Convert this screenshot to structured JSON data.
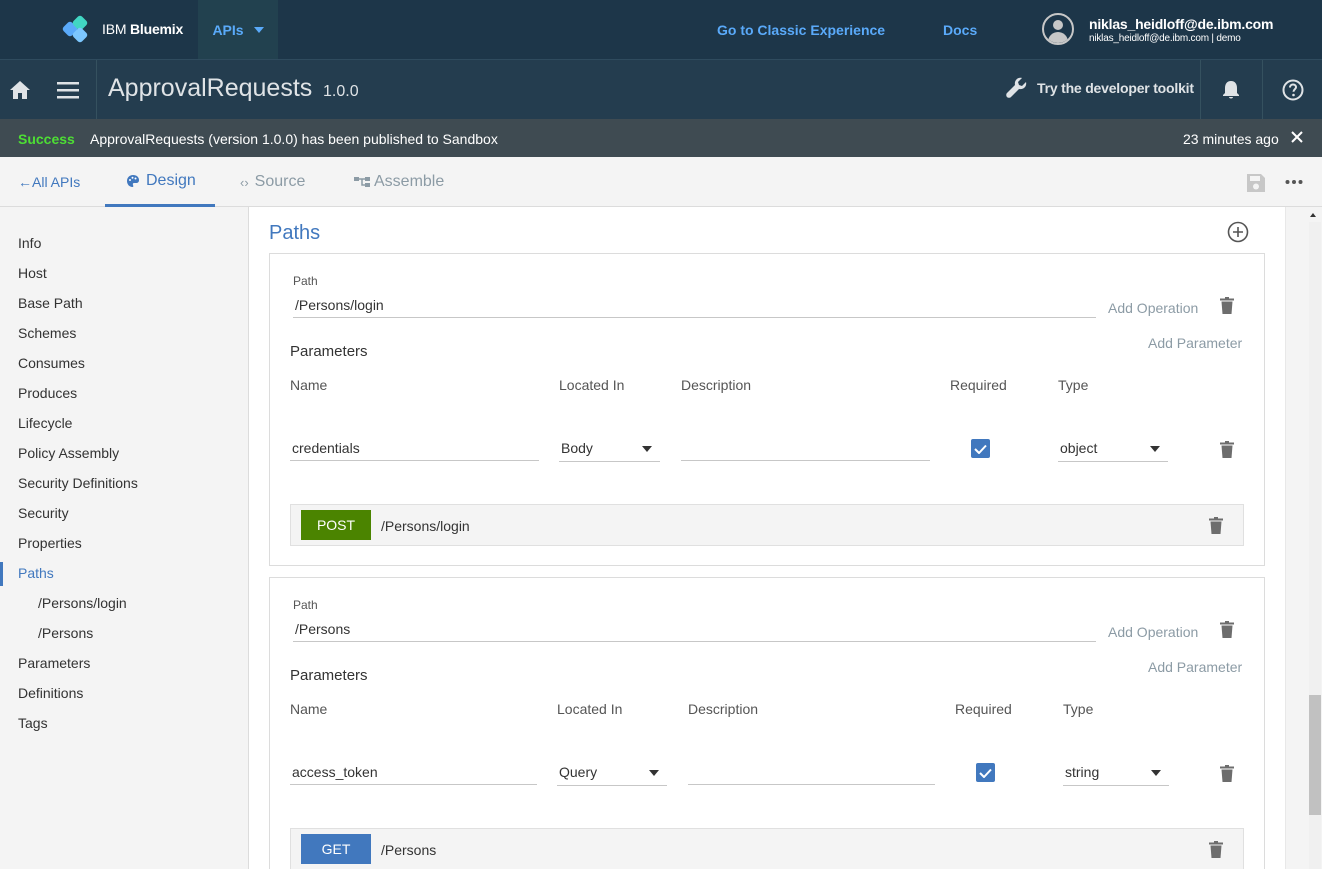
{
  "topnav": {
    "brand_prefix": "IBM",
    "brand_name": "Bluemix",
    "apis_label": "APIs",
    "classic_link": "Go to Classic Experience",
    "docs_link": "Docs",
    "user_name": "niklas_heidloff@de.ibm.com",
    "user_sub": "niklas_heidloff@de.ibm.com | demo"
  },
  "subnav": {
    "title": "ApprovalRequests",
    "version": "1.0.0",
    "toolkit_label": "Try the developer toolkit"
  },
  "banner": {
    "status": "Success",
    "message": "ApprovalRequests (version 1.0.0) has been published to Sandbox",
    "time": "23 minutes ago"
  },
  "tabs": {
    "back": "All APIs",
    "design": "Design",
    "source": "Source",
    "assemble": "Assemble"
  },
  "sidebar": {
    "items": [
      {
        "label": "Info"
      },
      {
        "label": "Host"
      },
      {
        "label": "Base Path"
      },
      {
        "label": "Schemes"
      },
      {
        "label": "Consumes"
      },
      {
        "label": "Produces"
      },
      {
        "label": "Lifecycle"
      },
      {
        "label": "Policy Assembly"
      },
      {
        "label": "Security Definitions"
      },
      {
        "label": "Security"
      },
      {
        "label": "Properties"
      },
      {
        "label": "Paths"
      },
      {
        "label": "/Persons/login"
      },
      {
        "label": "/Persons"
      },
      {
        "label": "Parameters"
      },
      {
        "label": "Definitions"
      },
      {
        "label": "Tags"
      }
    ]
  },
  "main": {
    "title": "Paths",
    "path_label": "Path",
    "add_operation": "Add Operation",
    "parameters_label": "Parameters",
    "add_parameter": "Add Parameter",
    "columns": {
      "name": "Name",
      "located_in": "Located In",
      "description": "Description",
      "required": "Required",
      "type": "Type"
    },
    "paths": [
      {
        "path": "/Persons/login",
        "param_name": "credentials",
        "param_in": "Body",
        "param_desc": "",
        "param_type": "object",
        "op_method": "POST",
        "op_path": "/Persons/login"
      },
      {
        "path": "/Persons",
        "param_name": "access_token",
        "param_in": "Query",
        "param_desc": "",
        "param_type": "string",
        "op_method": "GET",
        "op_path": "/Persons"
      }
    ]
  },
  "colors": {
    "accent": "#4178be",
    "nav_bg": "#1d3649",
    "post": "#4b8400",
    "get": "#4178be",
    "success": "#4dde34"
  }
}
